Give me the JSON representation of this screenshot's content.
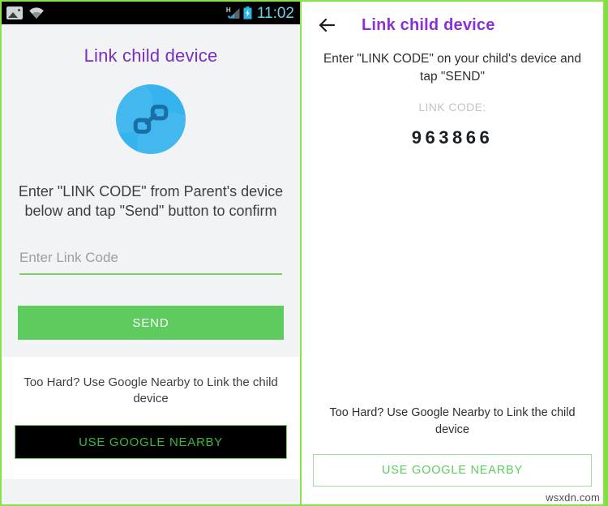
{
  "left_device": {
    "statusbar": {
      "gallery_icon": "gallery-icon",
      "wifi_icon": "wifi-icon",
      "signal_icon": "signal-icon",
      "signal_network_label": "H",
      "battery_icon": "battery-charging-icon",
      "clock": "11:02"
    },
    "title": "Link child device",
    "hero_icon": "chain-link-icon",
    "instructions": "Enter \"LINK CODE\" from Parent's device below and tap \"Send\" button to confirm",
    "input": {
      "placeholder": "Enter Link Code",
      "value": ""
    },
    "send_button": "SEND",
    "nearby_text": "Too Hard? Use Google Nearby to Link the child device",
    "nearby_button": "USE GOOGLE NEARBY"
  },
  "right_device": {
    "back_icon": "back-arrow-icon",
    "title": "Link child device",
    "instructions": "Enter \"LINK CODE\" on your child's device and tap \"SEND\"",
    "code_label": "LINK CODE:",
    "code": "963866",
    "nearby_text": "Too Hard? Use Google Nearby to Link the child device",
    "nearby_button": "USE GOOGLE NEARBY"
  },
  "watermark": "wsxdn.com",
  "colors": {
    "accent_green": "#5ecb5e",
    "border_green": "#88e34a",
    "title_purple": "#7b2fc1",
    "title_purple_right": "#8b2fd6",
    "link_circle_blue": "#35b3ee",
    "link_glyph_blue": "#1a6fa5",
    "statusbar_black": "#000000",
    "clock_cyan": "#6fd3e8"
  }
}
